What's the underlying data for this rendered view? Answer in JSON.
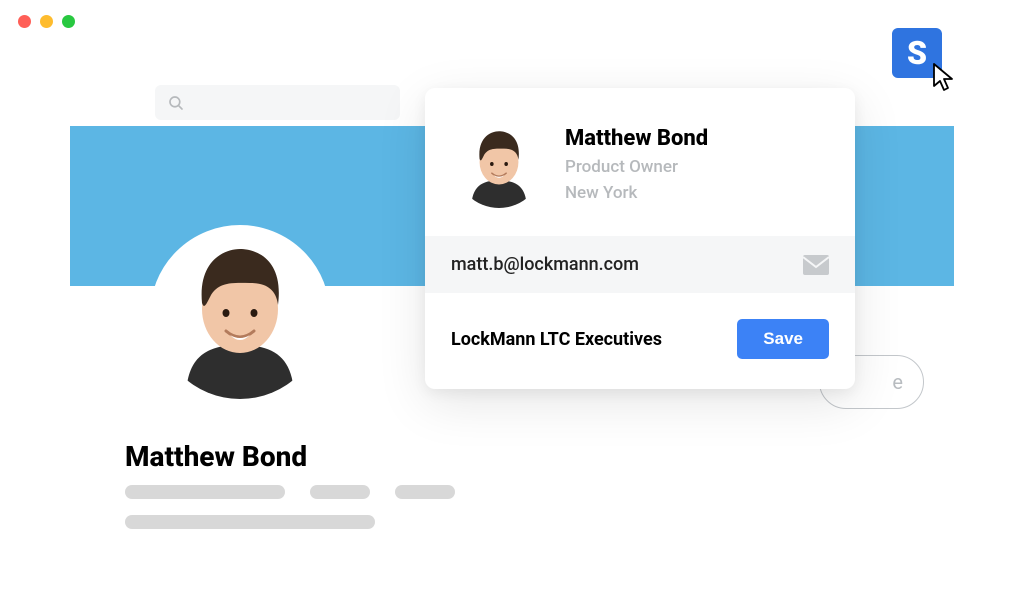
{
  "window": {
    "traffic": [
      "red",
      "yellow",
      "green"
    ]
  },
  "search": {
    "placeholder": ""
  },
  "profile": {
    "name": "Matthew Bond",
    "avatar_alt": "profile-photo"
  },
  "outline_button_trailing_char": "e",
  "extension": {
    "letter": "S"
  },
  "popup": {
    "name": "Matthew Bond",
    "title": "Product Owner",
    "location": "New York",
    "email": "matt.b@lockmann.com",
    "list_name": "LockMann LTC Executives",
    "save_label": "Save"
  }
}
